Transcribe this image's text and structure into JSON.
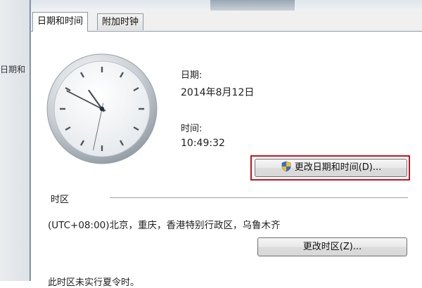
{
  "window": {
    "side_text": "日期和",
    "tabs": [
      {
        "label": "日期和时间",
        "active": true
      },
      {
        "label": "附加时钟",
        "active": false
      }
    ]
  },
  "date_section": {
    "date_label": "日期:",
    "date_value": "2014年8月12日",
    "time_label": "时间:",
    "time_value": "10:49:32"
  },
  "clock": {
    "hours": 10,
    "minutes": 49,
    "seconds": 32
  },
  "buttons": {
    "change_datetime": "更改日期和时间(D)...",
    "change_timezone": "更改时区(Z)..."
  },
  "timezone": {
    "header": "时区",
    "value": "(UTC+08:00)北京，重庆，香港特别行政区，乌鲁木齐"
  },
  "footer": {
    "partial_text": "此时区未实行夏令时。"
  },
  "colors": {
    "highlight": "#c0161e"
  }
}
